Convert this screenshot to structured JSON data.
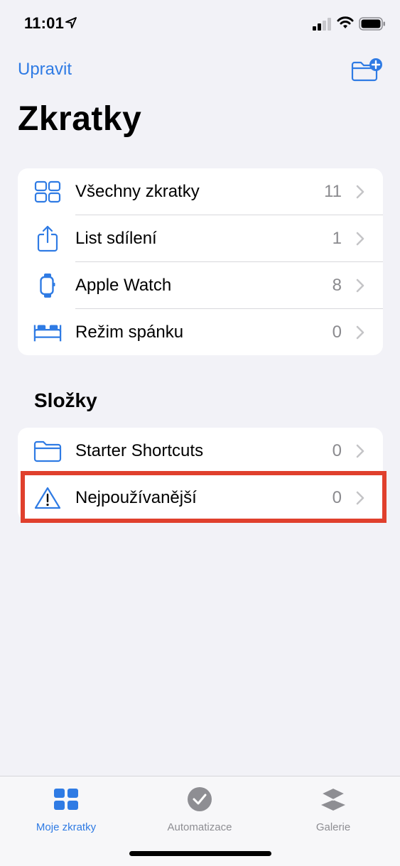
{
  "status": {
    "time": "11:01"
  },
  "nav": {
    "edit_label": "Upravit"
  },
  "title": "Zkratky",
  "main_items": [
    {
      "label": "Všechny zkratky",
      "count": "11",
      "icon": "grid-icon"
    },
    {
      "label": "List sdílení",
      "count": "1",
      "icon": "share-icon"
    },
    {
      "label": "Apple Watch",
      "count": "8",
      "icon": "watch-icon"
    },
    {
      "label": "Režim spánku",
      "count": "0",
      "icon": "bed-icon"
    }
  ],
  "folders": {
    "heading": "Složky",
    "items": [
      {
        "label": "Starter Shortcuts",
        "count": "0",
        "icon": "folder-icon"
      },
      {
        "label": "Nejpoužívanější",
        "count": "0",
        "icon": "warning-icon"
      }
    ]
  },
  "tabs": [
    {
      "label": "Moje zkratky",
      "icon": "shortcuts-grid-icon",
      "active": true
    },
    {
      "label": "Automatizace",
      "icon": "clock-check-icon",
      "active": false
    },
    {
      "label": "Galerie",
      "icon": "layers-icon",
      "active": false
    }
  ],
  "colors": {
    "accent": "#2f7be4",
    "highlight": "#e0402d",
    "inactive_tab": "#8e8e93",
    "background": "#f2f2f7"
  }
}
